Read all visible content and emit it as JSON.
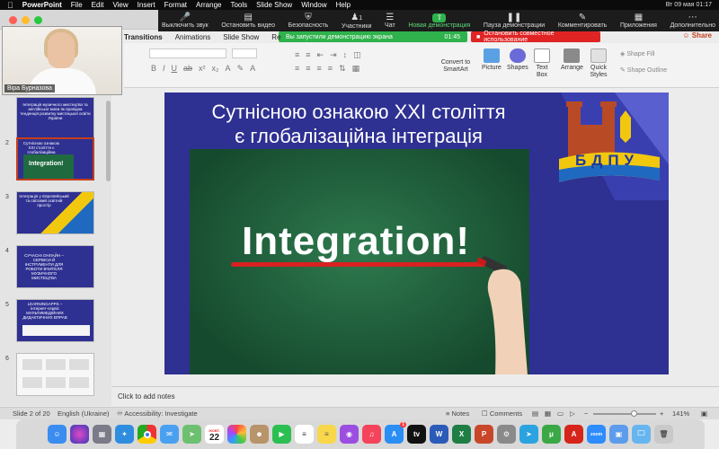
{
  "menubar": {
    "app_name": "PowerPoint",
    "items": [
      "File",
      "Edit",
      "View",
      "Insert",
      "Format",
      "Arrange",
      "Tools",
      "Slide Show",
      "Window",
      "Help"
    ],
    "clock": "Вт 09 мая 01:17"
  },
  "zoom": {
    "mute": "Выключить звук",
    "stop_video": "Остановить видео",
    "security": "Безопасность",
    "participants": "Участники",
    "participants_count": "1",
    "chat": "Чат",
    "new_share": "Новая демонстрация",
    "pause_share": "Пауза демонстрации",
    "annotate": "Комментировать",
    "apps": "Приложения",
    "more": "Дополнительно",
    "banner": "Вы запустили демонстрацию экрана",
    "timer": "01:45",
    "stop_share": "Остановить совместное использование"
  },
  "ribbon": {
    "tabs": [
      "Transitions",
      "Animations",
      "Slide Show",
      "Re"
    ],
    "active_tab": "Transitions",
    "share": "Share",
    "convert": "Convert to SmartArt",
    "picture": "Picture",
    "shapes": "Shapes",
    "text_box": "Text Box",
    "arrange": "Arrange",
    "quick_styles": "Quick Styles",
    "shape_fill": "Shape Fill",
    "shape_outline": "Shape Outline"
  },
  "webcam": {
    "name": "Віра Бурназова"
  },
  "thumbnails": [
    {
      "num": "",
      "text": "Інтеграція музичного мистецтва та англійської мови як провідна тенденція розвитку мистецької освіти України"
    },
    {
      "num": "2",
      "text": "Сутнісною ознакою XXI століття є глобалізаційна інтеграція"
    },
    {
      "num": "3",
      "text": "Інтеграція у Європейський та світовий освітній простір"
    },
    {
      "num": "4",
      "text": "СУЧАСНІ ОНЛАЙН – СЕРВІСИ Й ІНСТРУМЕНТИ ДЛЯ РОБОТИ ВЧИТЕЛЯ МУЗИЧНОГО МИСТЕЦТВА"
    },
    {
      "num": "5",
      "text": "LEARNINGAPPS – інтернет-сервіс МУЛЬТИМЕДІЙНИХ ДИДАКТИЧНИХ ВПРАВ"
    },
    {
      "num": "6",
      "text": ""
    }
  ],
  "slide": {
    "title": "Сутнісною ознакою XXI століття є глобалізаційна інтеграція",
    "board_word": "Integration!",
    "logo_text": "БДПУ"
  },
  "notes": {
    "placeholder": "Click to add notes"
  },
  "status": {
    "slide_info": "Slide 2 of 20",
    "language": "English (Ukraine)",
    "accessibility": "Accessibility: Investigate",
    "notes": "Notes",
    "comments": "Comments",
    "zoom": "141%"
  },
  "dock": {
    "calendar_day": "22",
    "calendar_month": "ЖОВТ.",
    "notification_badge": "1",
    "apps": [
      "finder-icon",
      "siri-icon",
      "launchpad-icon",
      "safari-icon",
      "chrome-icon",
      "mail-icon",
      "maps-icon",
      "calendar-icon",
      "photos-icon",
      "contacts-icon",
      "facetime-icon",
      "reminders-icon",
      "notes-icon",
      "podcasts-icon",
      "music-icon",
      "appstore-icon",
      "appletv-icon",
      "word-icon",
      "excel-icon",
      "powerpoint-icon",
      "settings-icon",
      "telegram-icon",
      "torrent-icon",
      "acrobat-icon",
      "zoom-icon",
      "preview-icon",
      "folder-icon",
      "trash-icon"
    ]
  }
}
